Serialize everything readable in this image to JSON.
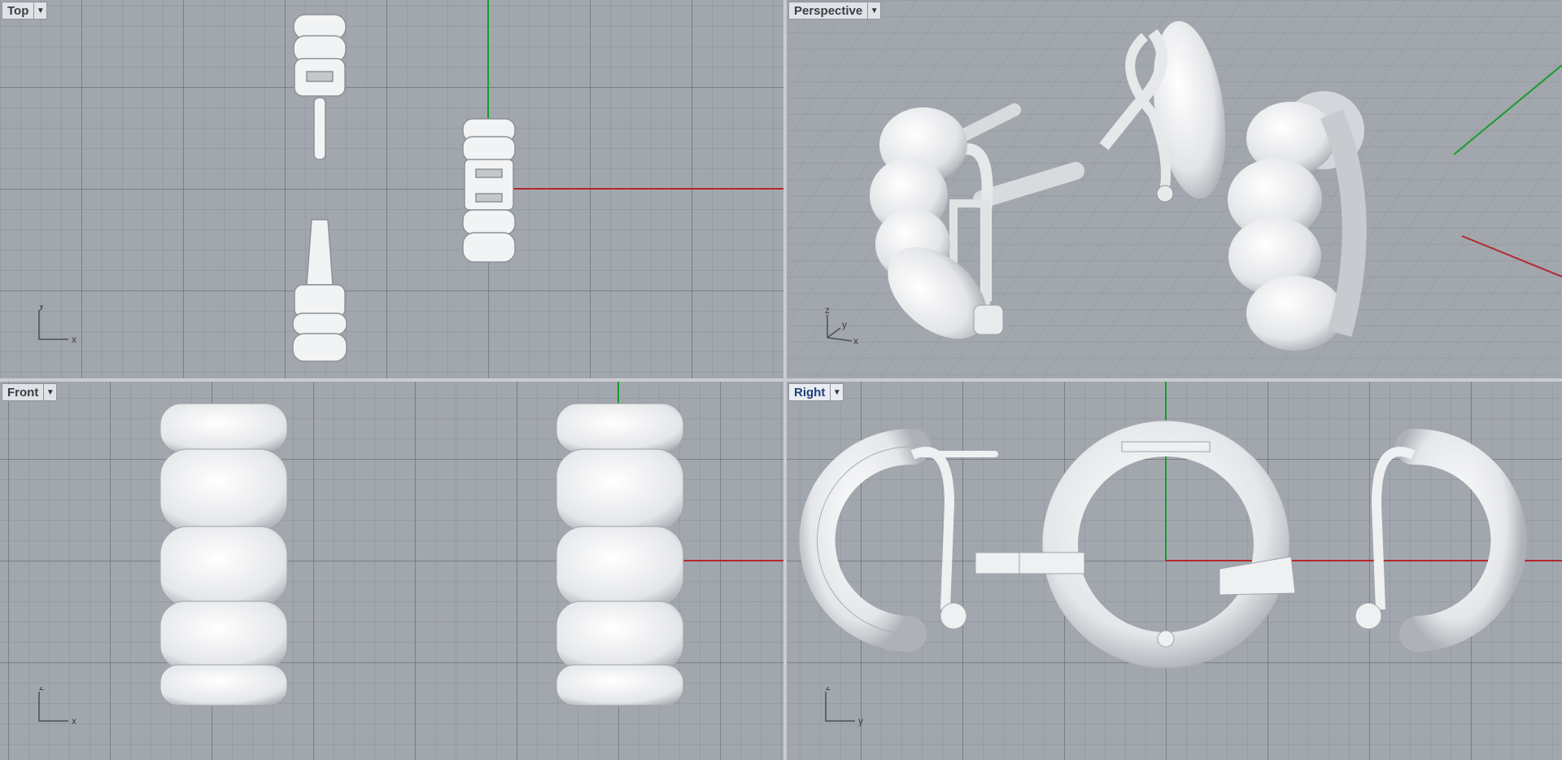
{
  "viewports": {
    "top": {
      "label": "Top",
      "axis_a": "y",
      "axis_b": "x"
    },
    "perspective": {
      "label": "Perspective",
      "axis_a": "z",
      "axis_b": "y",
      "axis_c": "x"
    },
    "front": {
      "label": "Front",
      "axis_a": "z",
      "axis_b": "x"
    },
    "right": {
      "label": "Right",
      "axis_a": "z",
      "axis_b": "y"
    }
  },
  "colors": {
    "viewport_bg": "#a2a7ae",
    "grid_major": "#62686f",
    "x_axis": "#b3272b",
    "y_axis": "#1a9a2a",
    "model": "#f2f3f4",
    "model_shade": "#b9bdc2"
  },
  "icons": [
    "dropdown-arrow-icon",
    "axis-triad-icon"
  ]
}
